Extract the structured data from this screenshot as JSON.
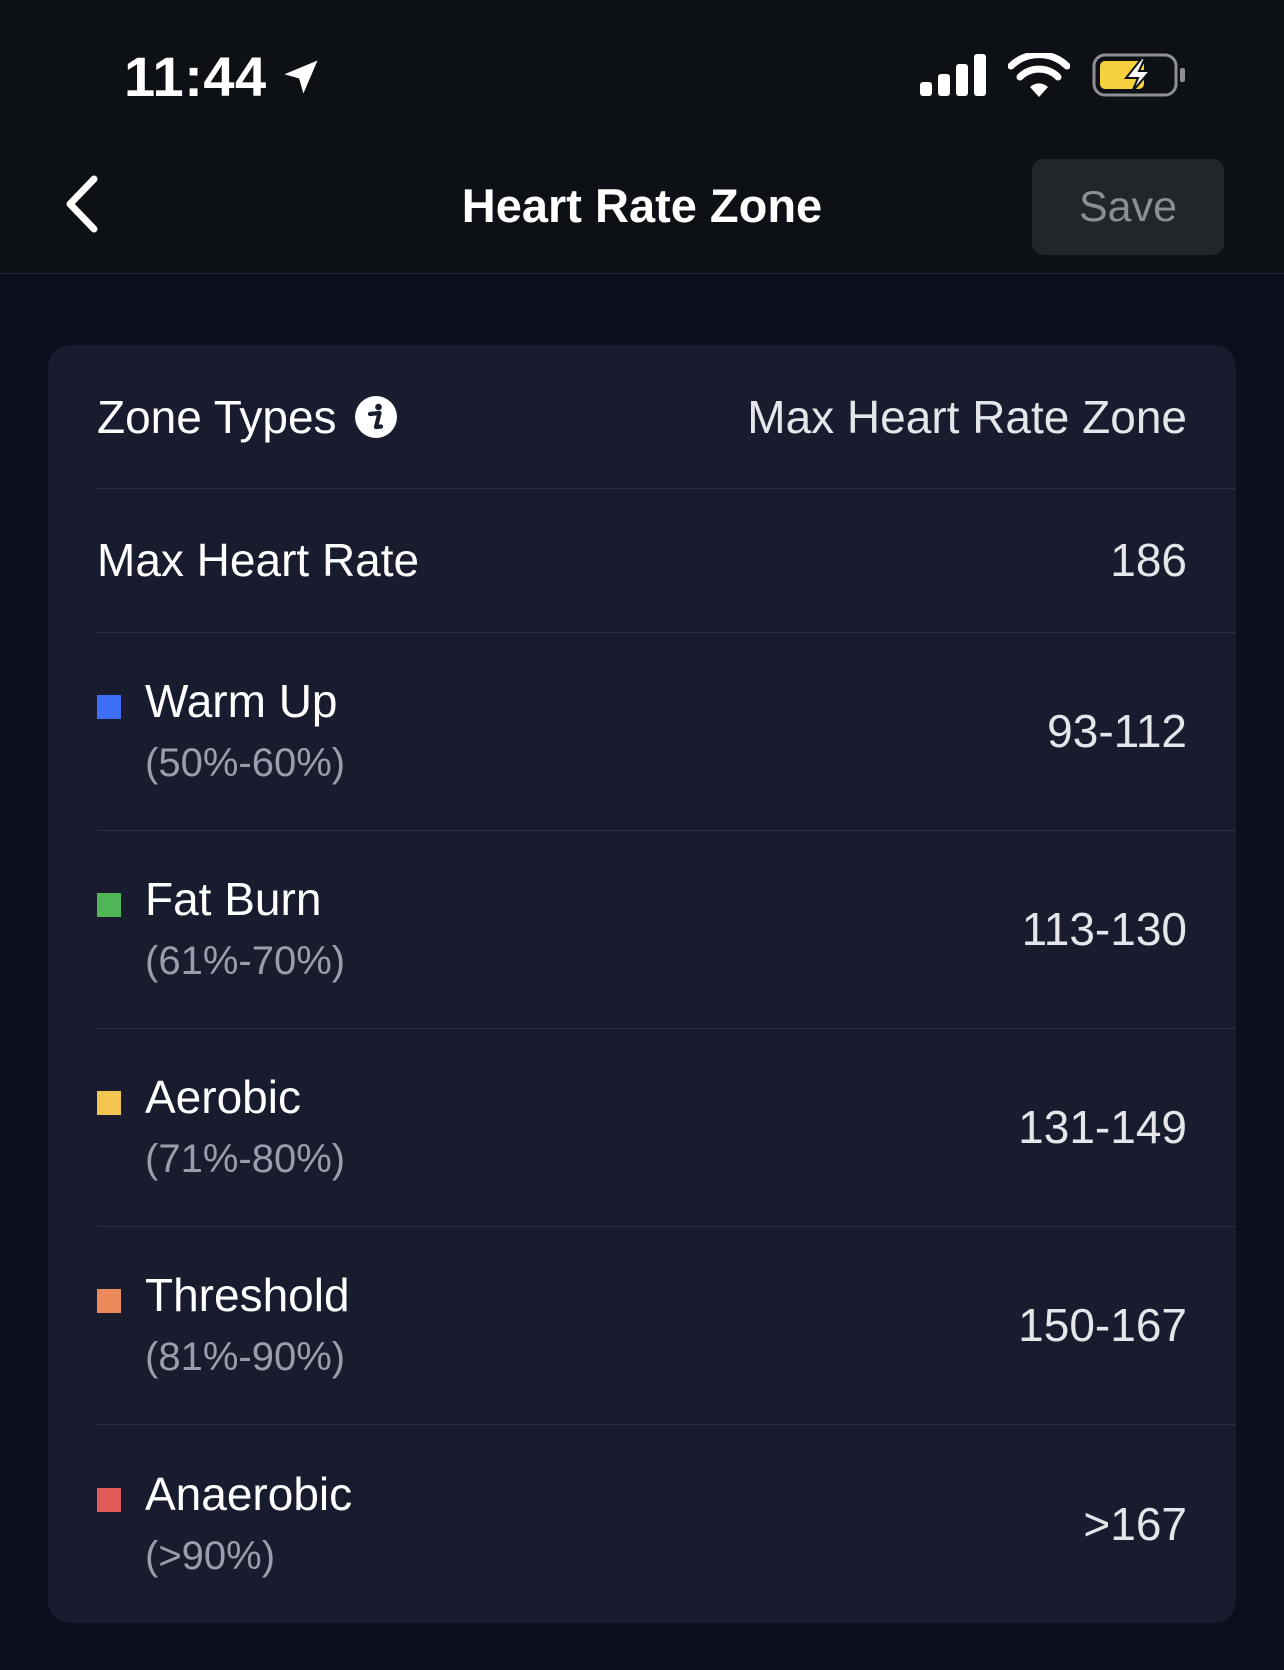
{
  "status_bar": {
    "time": "11:44",
    "icons": [
      "location-arrow-icon",
      "cellular-signal-icon",
      "wifi-icon",
      "battery-charging-icon"
    ]
  },
  "nav": {
    "back_icon": "chevron-left-icon",
    "title": "Heart Rate Zone",
    "save_label": "Save"
  },
  "settings": {
    "zone_types": {
      "label": "Zone Types",
      "info_icon": "info-icon",
      "value": "Max Heart Rate Zone"
    },
    "max_heart_rate": {
      "label": "Max Heart Rate",
      "value": "186"
    },
    "zones": [
      {
        "name": "Warm Up",
        "percent": "(50%-60%)",
        "range": "93-112",
        "color": "#3d6ef5"
      },
      {
        "name": "Fat Burn",
        "percent": "(61%-70%)",
        "range": "113-130",
        "color": "#4fb556"
      },
      {
        "name": "Aerobic",
        "percent": "(71%-80%)",
        "range": "131-149",
        "color": "#f2c651"
      },
      {
        "name": "Threshold",
        "percent": "(81%-90%)",
        "range": "150-167",
        "color": "#ea8a5a"
      },
      {
        "name": "Anaerobic",
        "percent": "(>90%)",
        "range": ">167",
        "color": "#e35a5a"
      }
    ]
  },
  "colors": {
    "background": "#0a0e1f",
    "card": "#181c2e",
    "topbar": "#0d1116",
    "battery_fill": "#f4d13d"
  }
}
